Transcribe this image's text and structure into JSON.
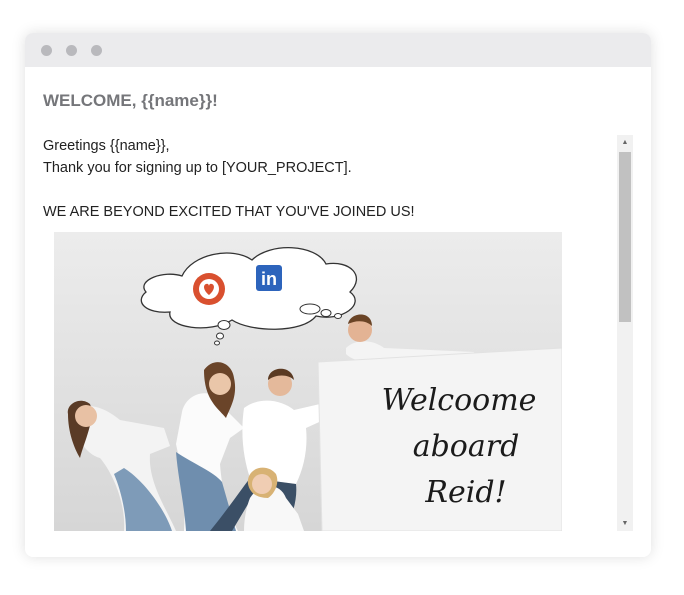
{
  "window": {
    "controls": [
      "close",
      "minimize",
      "maximize"
    ]
  },
  "email": {
    "heading": "WELCOME, {{name}}!",
    "greeting": "Greetings {{name}},",
    "thanks": "Thank you for signing up to [YOUR_PROJECT].",
    "excited": "WE ARE BEYOND EXCITED THAT YOU'VE JOINED US!",
    "sign_lines": [
      "Welcoome",
      "aboard",
      "Reid!"
    ]
  },
  "icons": {
    "heart": "heart-icon",
    "linkedin": "linkedin-icon",
    "linkedin_text": "in"
  },
  "colors": {
    "heading": "#75767a",
    "titlebar": "#ebebed",
    "heart_badge": "#d9502f",
    "linkedin": "#2d64bc"
  },
  "scrollbar": {
    "up": "▲",
    "down": "▼"
  }
}
